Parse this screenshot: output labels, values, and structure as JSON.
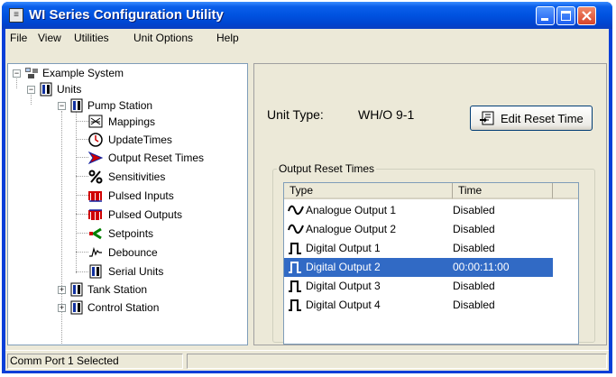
{
  "window": {
    "title": "WI Series Configuration Utility",
    "app_icon_glyph": "≡"
  },
  "menu": [
    "File",
    "View",
    "Utilities",
    "Unit Options",
    "Help"
  ],
  "tree": {
    "root": "Example System",
    "units": "Units",
    "pump_station": "Pump Station",
    "children": [
      "Mappings",
      "UpdateTimes",
      "Output Reset Times",
      "Sensitivities",
      "Pulsed Inputs",
      "Pulsed Outputs",
      "Setpoints",
      "Debounce",
      "Serial Units"
    ],
    "tank_station": "Tank Station",
    "control_station": "Control Station"
  },
  "detail": {
    "unit_type_label": "Unit Type:",
    "unit_type_value": "WH/O 9-1",
    "edit_button": "Edit Reset Time",
    "group_title": "Output Reset Times",
    "columns": [
      "Type",
      "Time"
    ],
    "rows": [
      {
        "type": "Analogue Output 1",
        "time": "Disabled",
        "icon": "analogue-icon",
        "selected": false
      },
      {
        "type": "Analogue Output 2",
        "time": "Disabled",
        "icon": "analogue-icon",
        "selected": false
      },
      {
        "type": "Digital Output 1",
        "time": "Disabled",
        "icon": "digital-icon",
        "selected": false
      },
      {
        "type": "Digital Output 2",
        "time": "00:00:11:00",
        "icon": "digital-icon",
        "selected": true
      },
      {
        "type": "Digital Output 3",
        "time": "Disabled",
        "icon": "digital-icon",
        "selected": false
      },
      {
        "type": "Digital Output 4",
        "time": "Disabled",
        "icon": "digital-icon",
        "selected": false
      }
    ]
  },
  "status": {
    "text": "Comm Port 1 Selected"
  },
  "colors": {
    "title_bar": "#0a5fea",
    "selection": "#316ac5",
    "face": "#ece9d8"
  }
}
